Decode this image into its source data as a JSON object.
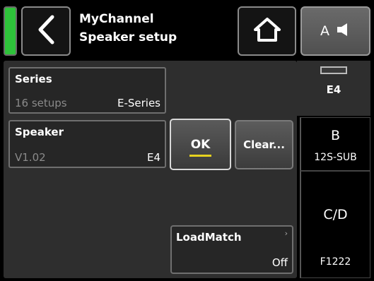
{
  "header": {
    "title": "MyChannel",
    "subtitle": "Speaker setup",
    "channel_button": {
      "letter": "A",
      "icon": "speaker-icon"
    },
    "back_icon": "chevron-left-icon",
    "home_icon": "home-icon"
  },
  "series": {
    "title": "Series",
    "count": "16 setups",
    "value": "E-Series"
  },
  "speaker": {
    "title": "Speaker",
    "version": "V1.02",
    "value": "E4"
  },
  "buttons": {
    "ok_label": "OK",
    "clear_label": "Clear..."
  },
  "loadmatch": {
    "title": "LoadMatch",
    "value": "Off"
  },
  "channel_tabs": [
    {
      "label": "E4"
    },
    {
      "letter": "B",
      "model": "12S-SUB"
    },
    {
      "letter": "C/D",
      "model": "F1222"
    }
  ],
  "colors": {
    "status_ok": "#2ec23a",
    "accent_underline": "#e6d21f",
    "panel_bg": "#2e2e2e"
  }
}
